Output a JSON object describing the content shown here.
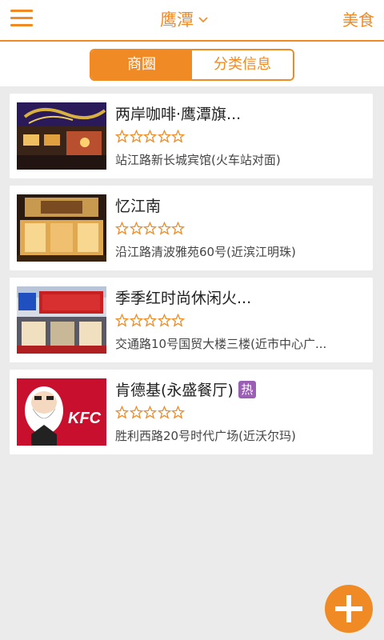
{
  "header": {
    "city": "鹰潭",
    "category": "美食"
  },
  "tabs": [
    {
      "label": "商圈",
      "active": true
    },
    {
      "label": "分类信息",
      "active": false
    }
  ],
  "shops": [
    {
      "name": "两岸咖啡·鹰潭旗...",
      "rating": 0,
      "address": "站江路新长城宾馆(火车站对面)",
      "hot": false
    },
    {
      "name": "忆江南",
      "rating": 0,
      "address": "沿江路清波雅苑60号(近滨江明珠)",
      "hot": false
    },
    {
      "name": "季季红时尚休闲火...",
      "rating": 0,
      "address": "交通路10号国贸大楼三楼(近市中心广...",
      "hot": false
    },
    {
      "name": "肯德基(永盛餐厅)",
      "rating": 0,
      "address": "胜利西路20号时代广场(近沃尔玛)",
      "hot": true,
      "hot_label": "热"
    }
  ],
  "colors": {
    "accent": "#f08a24",
    "hot_badge": "#9a5fb5",
    "background": "#ebebeb"
  },
  "icons": {
    "menu": "hamburger-menu-icon",
    "city_dropdown": "chevron-down-icon",
    "rating": "star-outline-icon",
    "add": "plus-icon"
  }
}
